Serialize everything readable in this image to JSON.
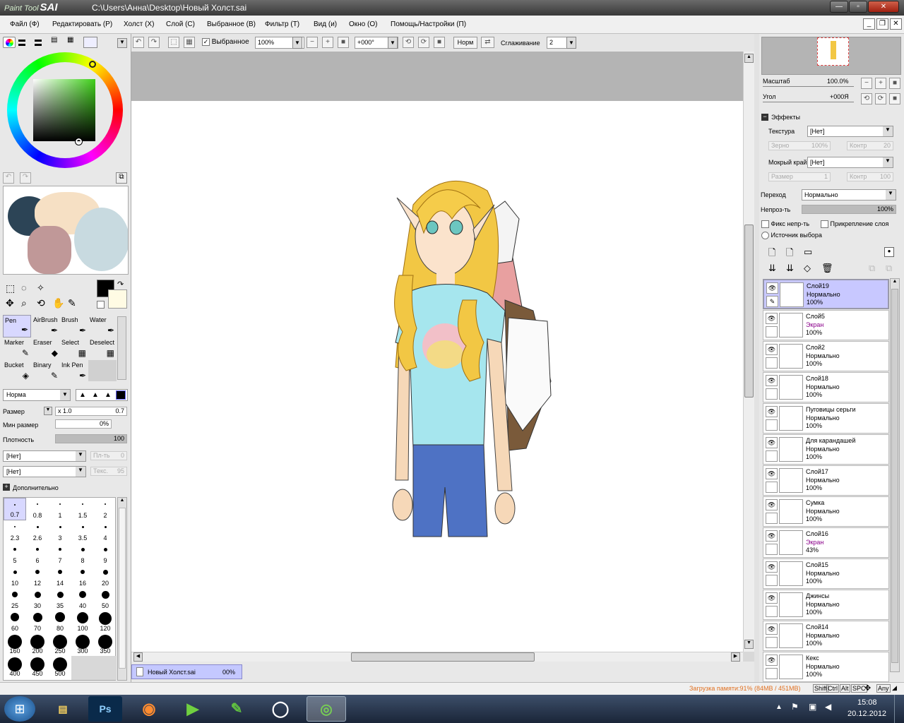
{
  "window": {
    "logo_small": "Paint Tool",
    "logo_big": "SAI",
    "path": "C:\\Users\\Анна\\Desktop\\Новый Холст.sai",
    "minimize": "—",
    "maximize": "▫",
    "close": "✕"
  },
  "menu": [
    "Файл (Ф)",
    "Редактировать (Р)",
    "Холст (Х)",
    "Слой (С)",
    "Выбранное (В)",
    "Фильтр (Т)",
    "Вид (и)",
    "Окно (О)",
    "Помощь/Настройки (П)"
  ],
  "toolbar": {
    "selected_label": "Выбранное",
    "zoom": "100%",
    "angle": "+000°",
    "mode": "Норм",
    "smoothing_label": "Сглаживание",
    "smoothing_value": "2"
  },
  "left": {
    "tools": [
      {
        "label": "Pen"
      },
      {
        "label": "AirBrush"
      },
      {
        "label": "Brush"
      },
      {
        "label": "Water"
      },
      {
        "label": "Marker"
      },
      {
        "label": "Eraser"
      },
      {
        "label": "Select"
      },
      {
        "label": "Deselect"
      },
      {
        "label": "Bucket"
      },
      {
        "label": "Binary"
      },
      {
        "label": "Ink Pen"
      }
    ],
    "blend_mode": "Норма",
    "size_label": "Размер",
    "size_mult": "x 1.0",
    "size_value": "0.7",
    "min_size_label": "Мин размер",
    "min_size_value": "0%",
    "density_label": "Плотность",
    "density_value": "100",
    "paper1": "[Нет]",
    "paper1_label": "Пл-ть",
    "paper1_value": "0",
    "paper2": "[Нет]",
    "paper2_label": "Текс.",
    "paper2_value": "95",
    "extra_label": "Дополнительно",
    "brush_sizes": [
      "0.7",
      "0.8",
      "1",
      "1.5",
      "2",
      "2.3",
      "2.6",
      "3",
      "3.5",
      "4",
      "5",
      "6",
      "7",
      "8",
      "9",
      "10",
      "12",
      "14",
      "16",
      "20",
      "25",
      "30",
      "35",
      "40",
      "50",
      "60",
      "70",
      "80",
      "100",
      "120",
      "160",
      "200",
      "250",
      "300",
      "350",
      "400",
      "450",
      "500"
    ]
  },
  "canvas_tab": {
    "name": "Новый Холст.sai",
    "percent": "00%"
  },
  "right": {
    "zoom_label": "Масштаб",
    "zoom_value": "100.0%",
    "angle_label": "Угол",
    "angle_value": "+000Я",
    "effects_label": "Эффекты",
    "texture_label": "Текстура",
    "texture_value": "[Нет]",
    "grain_label": "Зерно",
    "grain_value": "100%",
    "contrast_label": "Контр",
    "contrast_value": "20",
    "wet_label": "Мокрый край",
    "wet_value": "[Нет]",
    "size_label": "Размер",
    "size_value": "1",
    "contrast2_label": "Контр",
    "contrast2_value": "100",
    "blend_label": "Переход",
    "blend_value": "Нормально",
    "opacity_label": "Непроз-ть",
    "opacity_value": "100%",
    "lock_opacity": "Фикс непр-ть",
    "clip_layer": "Прикрепление слоя",
    "selection_source": "Источник выбора"
  },
  "layers": [
    {
      "name": "Слой19",
      "mode": "Нормально",
      "opacity": "100%"
    },
    {
      "name": "Слой5",
      "mode": "Экран",
      "opacity": "100%"
    },
    {
      "name": "Слой2",
      "mode": "Нормально",
      "opacity": "100%"
    },
    {
      "name": "Слой18",
      "mode": "Нормально",
      "opacity": "100%"
    },
    {
      "name": "Пуговицы серьги",
      "mode": "Нормально",
      "opacity": "100%"
    },
    {
      "name": "Для карандашей",
      "mode": "Нормально",
      "opacity": "100%"
    },
    {
      "name": "Слой17",
      "mode": "Нормально",
      "opacity": "100%"
    },
    {
      "name": "Сумка",
      "mode": "Нормально",
      "opacity": "100%"
    },
    {
      "name": "Слой16",
      "mode": "Экран",
      "opacity": "43%"
    },
    {
      "name": "Слой15",
      "mode": "Нормально",
      "opacity": "100%"
    },
    {
      "name": "Джинсы",
      "mode": "Нормально",
      "opacity": "100%"
    },
    {
      "name": "Слой14",
      "mode": "Нормально",
      "opacity": "100%"
    },
    {
      "name": "Кекс",
      "mode": "Нормально",
      "opacity": "100%"
    }
  ],
  "status": {
    "memory": "Загрузка памяти:91% (84MB / 451MB)",
    "keys": [
      "Shift",
      "Ctrl",
      "Alt",
      "SPC",
      "Any"
    ]
  },
  "taskbar": {
    "time": "15:08",
    "date": "20.12.2012",
    "apps": [
      "Explorer",
      "Ps",
      "Firefox",
      "Media",
      "Evernote",
      "Opera",
      "SAI"
    ]
  }
}
